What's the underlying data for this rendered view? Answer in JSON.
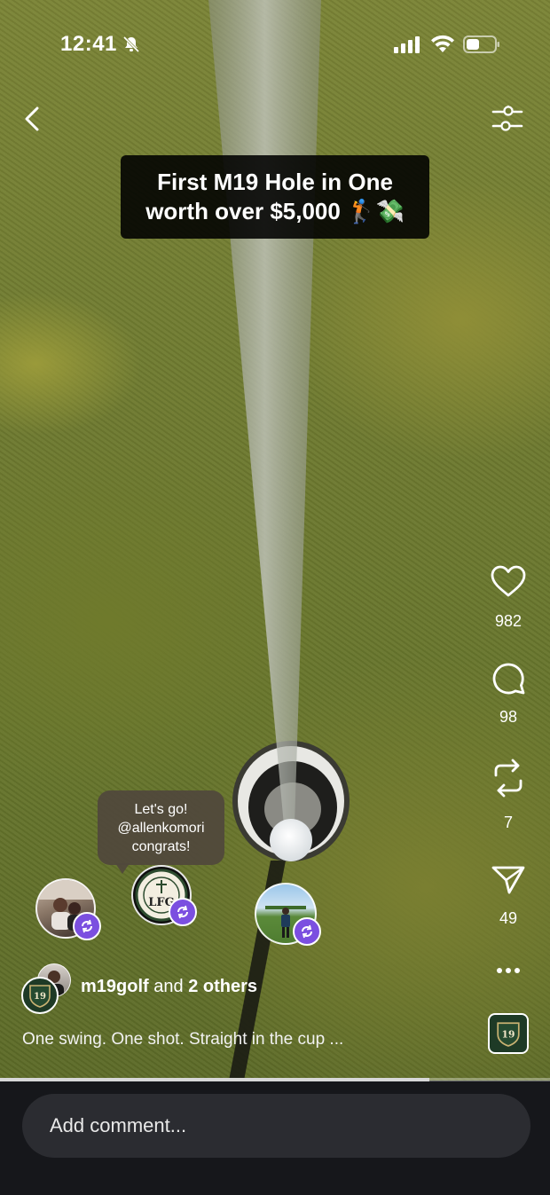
{
  "status_bar": {
    "time": "12:41"
  },
  "header": {
    "back_icon": "chevron-left-icon",
    "filter_icon": "filter-sliders-icon"
  },
  "video": {
    "caption_line1": "First M19 Hole in One",
    "caption_line2": "worth over $5,000 🏌️💸"
  },
  "actions": {
    "likes": "982",
    "comments": "98",
    "reposts": "7",
    "shares": "49",
    "more_icon": "more-dots-icon"
  },
  "reposters": {
    "bubble_line1": "Let's go!",
    "bubble_line2": "@allenkomori",
    "bubble_line3": "congrats!",
    "badge_logo_text": "LFG"
  },
  "post": {
    "username": "m19golf",
    "and_text": "and",
    "others": "2 others",
    "description": "One swing. One shot. Straight in the cup ...",
    "logo_text": "19"
  },
  "progress": {
    "fraction": 0.78
  },
  "comment": {
    "placeholder": "Add comment..."
  }
}
